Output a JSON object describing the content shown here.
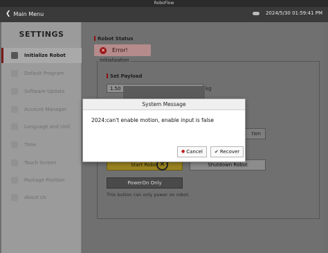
{
  "window": {
    "title": "RoboFlow"
  },
  "header": {
    "back_label": "Main Menu",
    "datetime": "2024/5/30 01:59:41 PM"
  },
  "sidebar": {
    "title": "SETTINGS",
    "items": [
      {
        "label": "Initialize Robot",
        "icon": "robot-icon"
      },
      {
        "label": "Default Program",
        "icon": "program-icon"
      },
      {
        "label": "Software Update",
        "icon": "update-icon"
      },
      {
        "label": "Account Manager",
        "icon": "account-icon"
      },
      {
        "label": "Language and Unit",
        "icon": "language-icon"
      },
      {
        "label": "Time",
        "icon": "clock-icon"
      },
      {
        "label": "Touch Screen",
        "icon": "touch-icon"
      },
      {
        "label": "Package Position",
        "icon": "package-icon"
      },
      {
        "label": "About Us",
        "icon": "info-icon"
      }
    ]
  },
  "main": {
    "robot_status_label": "Robot Status",
    "status_text": "Error!",
    "init_legend": "Initialization",
    "set_payload_label": "Set Payload",
    "payload_value": "1.50",
    "payload_unit": "kg",
    "partial_button": "tion",
    "start_button": "Start Robot",
    "shutdown_button": "Shutdown Robot",
    "poweron_button": "PowerOn Only",
    "poweron_hint": "This button can only power on robot."
  },
  "modal": {
    "title": "System Message",
    "message": "2024:can't enable motion, enable input is false",
    "cancel": "Cancel",
    "recover": "Recover"
  }
}
